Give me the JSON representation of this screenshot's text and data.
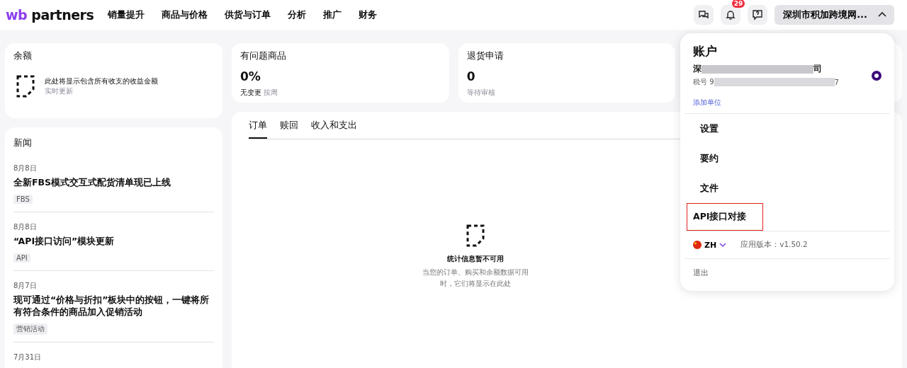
{
  "header": {
    "logo_mark": "wb",
    "logo_text": "partners",
    "nav": [
      "销量提升",
      "商品与价格",
      "供货与订单",
      "分析",
      "推广",
      "财务"
    ],
    "notifications_badge": "29",
    "account_button": "深圳市积加跨境网...",
    "account_expanded": true
  },
  "balance": {
    "title": "余额",
    "text": "此处将显示包含所有收支的收益金额",
    "note": "实时更新"
  },
  "problem_goods": {
    "title": "有问题商品",
    "value": "0%",
    "change": "无变更",
    "period": "按周"
  },
  "returns": {
    "title": "退货申请",
    "value": "0",
    "note": "等待审核"
  },
  "news": {
    "title": "新闻",
    "items": [
      {
        "date": "8月8日",
        "title": "全新FBS模式交互式配货清单现已上线",
        "tag": "FBS"
      },
      {
        "date": "8月8日",
        "title": "“API接口访问”模块更新",
        "tag": "API"
      },
      {
        "date": "8月7日",
        "title": "现可通过“价格与折扣”板块中的按钮，一键将所有符合条件的商品加入促销活动",
        "tag": "营销活动"
      },
      {
        "date": "7月31日"
      }
    ]
  },
  "stats": {
    "tabs": [
      {
        "label": "订单",
        "selected": true
      },
      {
        "label": "赎回",
        "selected": false
      },
      {
        "label": "收入和支出",
        "selected": false
      }
    ],
    "empty_title": "统计信息暂不可用",
    "empty_text": "当您的订单、购买和余额数据可用时，它们将显示在此处"
  },
  "account_menu": {
    "title": "账户",
    "company_start": "深",
    "company_end": "司",
    "tax_label": "税号 9",
    "tax_end": "7",
    "selected": true,
    "add_unit": "添加单位",
    "items": [
      {
        "label": "设置",
        "highlighted": false
      },
      {
        "label": "要约",
        "highlighted": false
      },
      {
        "label": "文件",
        "highlighted": false
      },
      {
        "label": "API接口对接",
        "highlighted": true
      }
    ],
    "language": "ZH",
    "version": "应用版本：v1.50.2",
    "logout": "退出"
  }
}
